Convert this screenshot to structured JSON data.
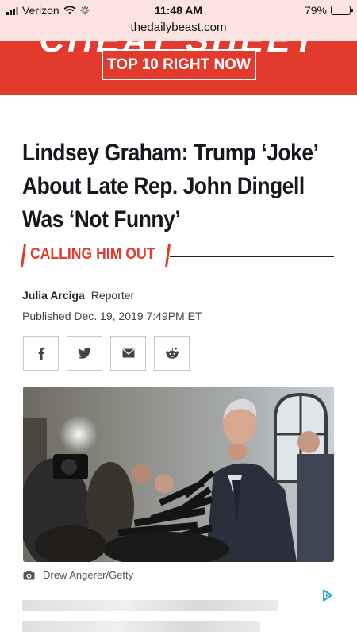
{
  "status_bar": {
    "carrier": "Verizon",
    "time": "11:48 AM",
    "battery": "79%",
    "battery_level": 0.79,
    "url": "thedailybeast.com"
  },
  "banner": {
    "big_text": "CHEAT SHEET",
    "button_label": "TOP 10 RIGHT NOW",
    "color": "#e23b2e"
  },
  "article": {
    "headline": "Lindsey Graham: Trump ‘Joke’ About Late Rep. John Dingell Was ‘Not Funny’",
    "tag": "CALLING HIM OUT",
    "author": "Julia Arciga",
    "author_role": "Reporter",
    "published": "Published Dec. 19, 2019 7:49PM ET",
    "photo_credit": "Drew Angerer/Getty"
  },
  "share": {
    "icons": [
      "facebook-icon",
      "twitter-icon",
      "email-icon",
      "reddit-icon"
    ]
  }
}
